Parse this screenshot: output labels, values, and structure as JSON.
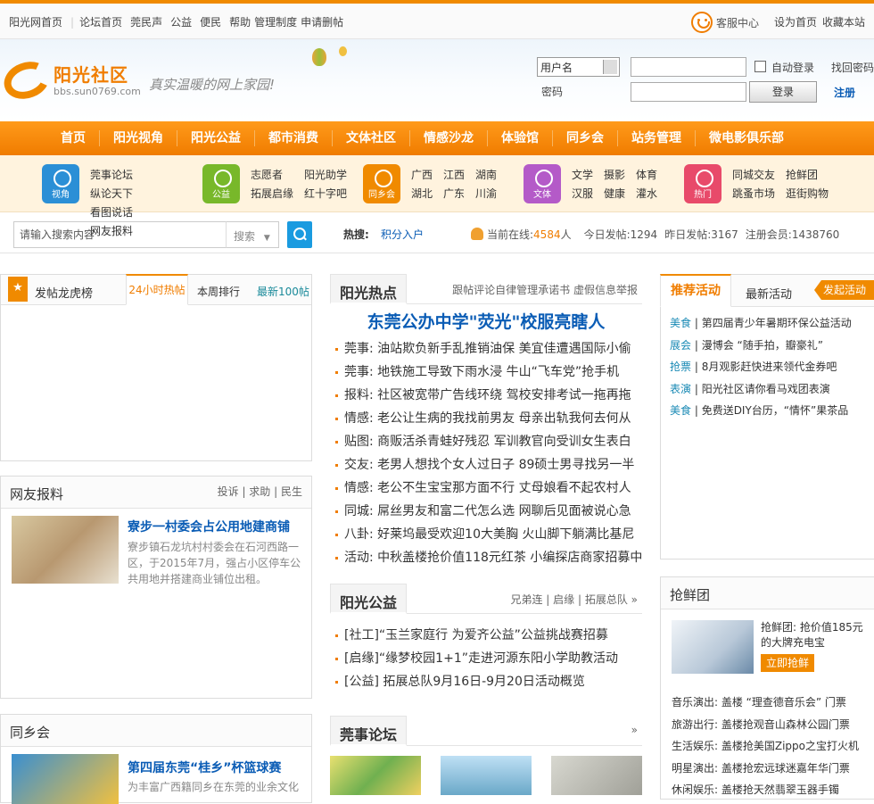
{
  "topbar": {
    "links": [
      "阳光网首页",
      "论坛首页",
      "莞民声",
      "公益",
      "便民",
      "帮助",
      "管理制度",
      "申请删帖"
    ],
    "kefu": "客服中心",
    "right": [
      "设为首页",
      "收藏本站"
    ]
  },
  "header": {
    "logo_name": "阳光社区",
    "logo_url": "bbs.sun0769.com",
    "slogan": "真实温暖的网上家园!"
  },
  "login": {
    "select": "用户名",
    "password_label": "密码",
    "auto_login": "自动登录",
    "login_btn": "登录",
    "find_pw": "找回密码",
    "register": "注册"
  },
  "nav": [
    "首页",
    "阳光视角",
    "阳光公益",
    "都市消费",
    "文体社区",
    "情感沙龙",
    "体验馆",
    "同乡会",
    "站务管理",
    "微电影俱乐部"
  ],
  "cats": [
    {
      "badge": "视角",
      "color": "#2b8fd6",
      "links": [
        "莞事论坛",
        "纵论天下",
        "看图说话",
        "网友报料"
      ]
    },
    {
      "badge": "公益",
      "color": "#78b82a",
      "links": [
        "志愿者",
        "阳光助学",
        "拓展启缘",
        "红十字吧"
      ]
    },
    {
      "badge": "同乡会",
      "color": "#f08a00",
      "links": [
        "广西",
        "江西",
        "湖南",
        "湖北",
        "广东",
        "川渝"
      ]
    },
    {
      "badge": "文体",
      "color": "#b45ac8",
      "links": [
        "文学",
        "摄影",
        "体育",
        "汉服",
        "健康",
        "灌水"
      ]
    },
    {
      "badge": "热门",
      "color": "#e84a6a",
      "links": [
        "同城交友",
        "抢鲜团",
        "跳蚤市场",
        "逛街购物"
      ]
    }
  ],
  "search": {
    "placeholder": "请输入搜索内容",
    "dropdown": "搜索",
    "hot_label": "热搜:",
    "hot_value": "积分入户"
  },
  "stats": {
    "online_label": "当前在线:",
    "online": "4584",
    "online_unit": "人",
    "today": "今日发帖:1294",
    "yesterday": "昨日发帖:3167",
    "members": "注册会员:1438760"
  },
  "tiger": {
    "title": "发帖龙虎榜",
    "tabs": [
      "24小时热帖",
      "本周排行",
      "最新100帖"
    ]
  },
  "baoliao": {
    "title": "网友报料",
    "links": [
      "投诉",
      "求助",
      "民生"
    ],
    "item_title": "寮步一村委会占公用地建商铺",
    "item_desc": "寮步镇石龙坑村村委会在石河西路一区，于2015年7月，强占小区停车公共用地并搭建商业铺位出租。"
  },
  "tongxiang": {
    "title": "同乡会",
    "item_title": "第四届东莞“桂乡”杯篮球赛",
    "item_desc": "为丰富广西籍同乡在东莞的业余文化"
  },
  "hot": {
    "title": "阳光热点",
    "right": "跟帖评论自律管理承诺书  虚假信息举报",
    "headline": "东莞公办中学\"荧光\"校服亮瞎人",
    "items": [
      "莞事: 油站欺负新手乱推销油保 美宜佳遭遇国际小偷",
      "莞事: 地铁施工导致下雨水浸 牛山“飞车党”抢手机",
      "报料: 社区被宽带广告线环绕 驾校安排考试一拖再拖",
      "情感: 老公让生病的我找前男友 母亲出轨我何去何从",
      "贴图: 商贩活杀青蛙好残忍 军训教官向受训女生表白",
      "交友: 老男人想找个女人过日子 89硕士男寻找另一半",
      "情感: 老公不生宝宝那方面不行 丈母娘看不起农村人",
      "同城: 屌丝男友和富二代怎么选 网聊后见面被说心急",
      "八卦: 好莱坞最受欢迎10大美胸 火山脚下躺满比基尼",
      "活动: 中秋盖楼抢价值118元红茶 小编探店商家招募中"
    ]
  },
  "gongyi": {
    "title": "阳光公益",
    "right": [
      "兄弟连",
      "启缘",
      "拓展总队"
    ],
    "items": [
      "[社工]“玉兰家庭行 为爱齐公益”公益挑战赛招募",
      "[启缘]“缘梦校园1+1”走进河源东阳小学助教活动",
      "[公益] 拓展总队9月16日-9月20日活动概览"
    ]
  },
  "guanshi": {
    "title": "莞事论坛"
  },
  "tuijian": {
    "title": "推荐活动",
    "tab2": "最新活动",
    "btn": "发起活动",
    "items": [
      {
        "tag": "美食",
        "text": "第四届青少年暑期环保公益活动"
      },
      {
        "tag": "展会",
        "text": "漫博会 “随手拍，瓣豪礼”"
      },
      {
        "tag": "抢票",
        "text": "8月观影赶快进来领代金券吧"
      },
      {
        "tag": "表演",
        "text": "阳光社区请你看马戏团表演"
      },
      {
        "tag": "美食",
        "text": "免费送DIY台历，“情怀”果茶品"
      }
    ]
  },
  "qiangxian": {
    "title": "抢鲜团",
    "item": "抢鲜团: 抢价值185元的大牌充电宝",
    "btn": "立即抢鲜",
    "items": [
      "音乐演出: 盖楼 “理查德音乐会” 门票",
      "旅游出行: 盖楼抢观音山森林公园门票",
      "生活娱乐: 盖楼抢美国Zippo之宝打火机",
      "明星演出: 盖楼抢宏远球迷嘉年华门票",
      "休闲娱乐: 盖楼抢天然翡翠玉器手镯"
    ]
  }
}
